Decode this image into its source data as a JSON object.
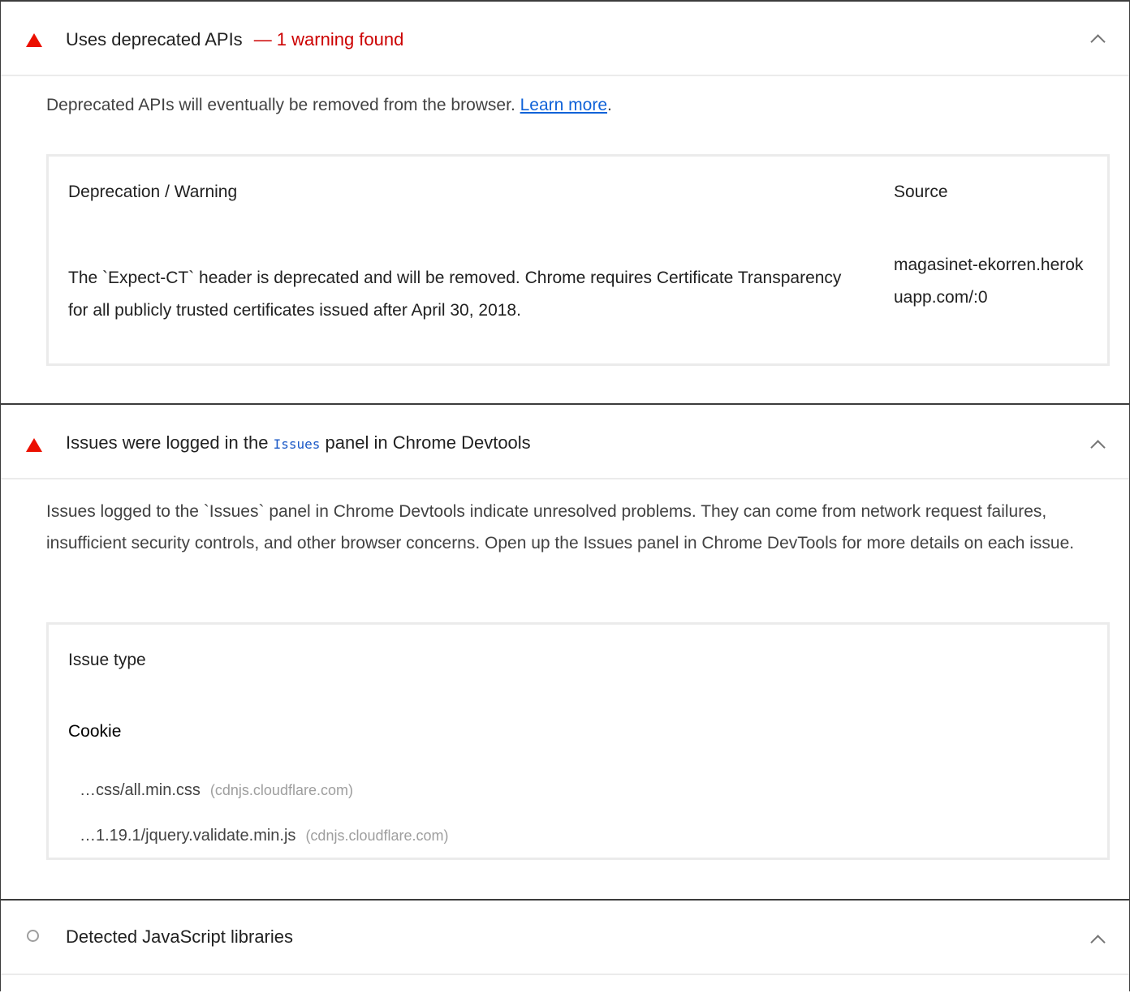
{
  "audits": {
    "deprecated": {
      "title": "Uses deprecated APIs",
      "warning": "— 1 warning found",
      "description": "Deprecated APIs will eventually be removed from the browser.",
      "learn_more": "Learn more",
      "period": ".",
      "columns": [
        "Deprecation / Warning",
        "Source"
      ],
      "rows": [
        {
          "warning": "The `Expect-CT` header is deprecated and will be removed. Chrome requires Certificate Transparency for all publicly trusted certificates issued after April 30, 2018.",
          "source": "magasinet-ekorren.herokuapp.com/:0"
        }
      ]
    },
    "issues": {
      "title_pre": "Issues were logged in the",
      "title_code": "Issues",
      "title_post": "panel in Chrome Devtools",
      "description": "Issues logged to the `Issues` panel in Chrome Devtools indicate unresolved problems. They can come from network request failures, insufficient security controls, and other browser concerns. Open up the Issues panel in Chrome DevTools for more details on each issue.",
      "column": "Issue type",
      "group": "Cookie",
      "items": [
        {
          "path": "…css/all.min.css",
          "host": "(cdnjs.cloudflare.com)"
        },
        {
          "path": "…1.19.1/jquery.validate.min.js",
          "host": "(cdnjs.cloudflare.com)"
        }
      ]
    },
    "libraries": {
      "title": "Detected JavaScript libraries"
    }
  },
  "colors": {
    "fail": "#eb0f00",
    "warning_text": "#cc0000",
    "link": "#0f62d8",
    "info": "#9e9e9e"
  },
  "icons": [
    "fail-triangle-icon",
    "info-circle-icon",
    "chevron-up-icon"
  ]
}
